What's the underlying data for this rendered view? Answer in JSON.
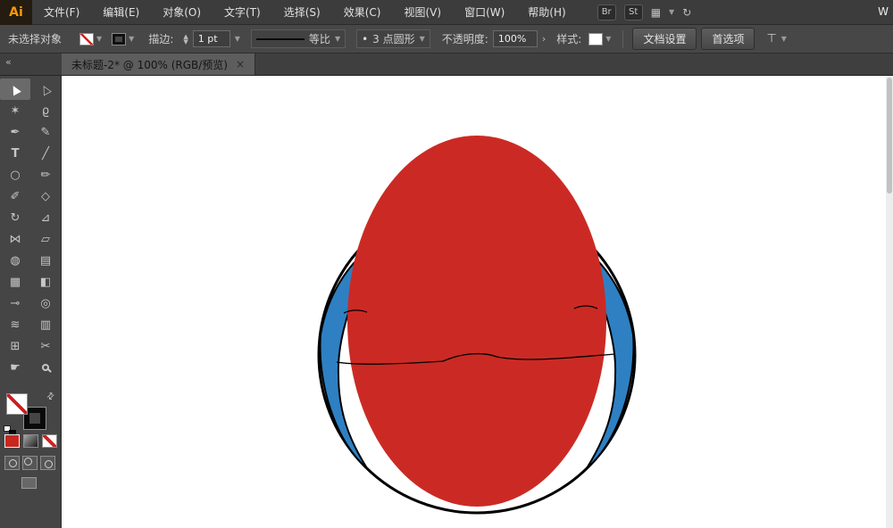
{
  "menubar": {
    "logo": "Ai",
    "items": [
      "文件(F)",
      "编辑(E)",
      "对象(O)",
      "文字(T)",
      "选择(S)",
      "效果(C)",
      "视图(V)",
      "窗口(W)",
      "帮助(H)"
    ],
    "badge_br": "Br",
    "badge_st": "St",
    "arrange_icon": "▦",
    "sync_icon": "↻",
    "workspace_hint": "W"
  },
  "control_bar": {
    "selection_status": "未选择对象",
    "stroke_label": "描边:",
    "stroke_width": "1 pt",
    "stepper_up": "▲",
    "stepper_down": "▼",
    "profile_label": "等比",
    "brush_dot": "•",
    "brush_name": "3 点圆形",
    "opacity_label": "不透明度:",
    "opacity_value": "100%",
    "style_label": "样式:",
    "btn_document_setup": "文档设置",
    "btn_preferences": "首选项",
    "align_icon": "⊤",
    "chevron": "▼",
    "chevron_right": "›"
  },
  "tab": {
    "title": "未标题-2* @ 100% (RGB/预览)",
    "close": "×"
  },
  "toolbar": {
    "collapse": "«",
    "tools": [
      {
        "name": "selection",
        "glyph": "▲"
      },
      {
        "name": "direct-selection",
        "glyph": "△"
      },
      {
        "name": "magic-wand",
        "glyph": "✶"
      },
      {
        "name": "lasso",
        "glyph": "ϱ"
      },
      {
        "name": "pen",
        "glyph": "✒"
      },
      {
        "name": "paintbrush",
        "glyph": "✎"
      },
      {
        "name": "type",
        "glyph": "T"
      },
      {
        "name": "line-segment",
        "glyph": "╱"
      },
      {
        "name": "ellipse",
        "glyph": "○"
      },
      {
        "name": "pencil",
        "glyph": "✏"
      },
      {
        "name": "blob-brush",
        "glyph": "✐"
      },
      {
        "name": "eraser",
        "glyph": "◇"
      },
      {
        "name": "rotate",
        "glyph": "↻"
      },
      {
        "name": "scale",
        "glyph": "⊿"
      },
      {
        "name": "width",
        "glyph": "⋈"
      },
      {
        "name": "free-transform",
        "glyph": "▱"
      },
      {
        "name": "shape-builder",
        "glyph": "◍"
      },
      {
        "name": "perspective-grid",
        "glyph": "▤"
      },
      {
        "name": "mesh",
        "glyph": "▦"
      },
      {
        "name": "gradient",
        "glyph": "◧"
      },
      {
        "name": "eyedropper",
        "glyph": "⊸"
      },
      {
        "name": "blend",
        "glyph": "◎"
      },
      {
        "name": "symbol-sprayer",
        "glyph": "≋"
      },
      {
        "name": "column-graph",
        "glyph": "▥"
      },
      {
        "name": "artboard",
        "glyph": "⊞"
      },
      {
        "name": "slice",
        "glyph": "✂"
      },
      {
        "name": "hand",
        "glyph": "☛"
      },
      {
        "name": "zoom",
        "glyph": ""
      }
    ]
  },
  "canvas": {
    "colors": {
      "red": "#cb2a24",
      "blue": "#2e80c3",
      "outline": "#000000",
      "background": "#ffffff"
    }
  }
}
